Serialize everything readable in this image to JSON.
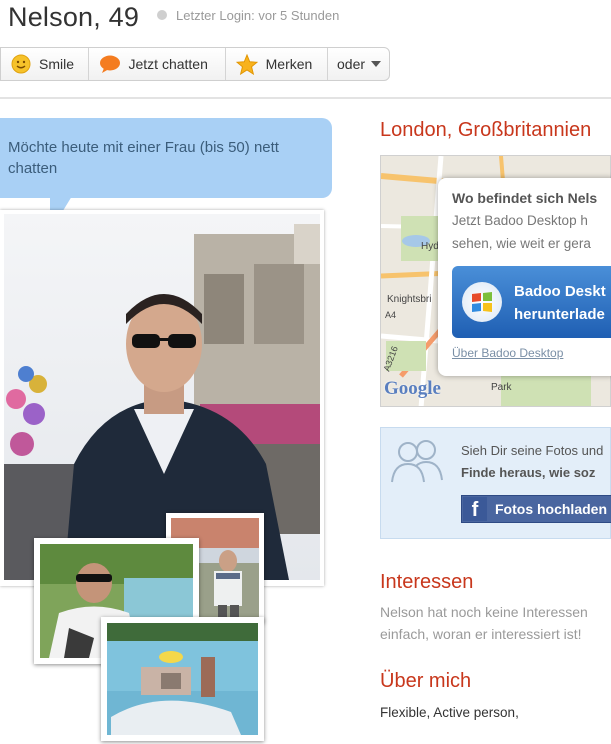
{
  "profile": {
    "name_age": "Nelson, 49",
    "last_login": "Letzter Login: vor 5 Stunden",
    "status_color": "#cfcfcf"
  },
  "actions": {
    "smile": "Smile",
    "chat": "Jetzt chatten",
    "merken": "Merken",
    "oder": "oder"
  },
  "bubble": {
    "text": "Möchte heute mit einer Frau (bis 50) nett chatten"
  },
  "location": {
    "title": "London, Großbritannien",
    "map_labels": [
      "Hyd",
      "Knightsbri",
      "A4",
      "A3216",
      "Park"
    ],
    "google": "Google",
    "popup": {
      "title": "Wo befindet sich Nels",
      "line1": "Jetzt Badoo Desktop h",
      "line2": "sehen, wie weit er gera",
      "download_line1": "Badoo Deskt",
      "download_line2": "herunterlade",
      "link": "Über Badoo Desktop"
    }
  },
  "photos_box": {
    "line1": "Sieh Dir seine Fotos und",
    "line2": "Finde heraus, wie soz",
    "fb_button": "Fotos hochladen",
    "fb_icon": "f"
  },
  "interests": {
    "heading": "Interessen",
    "line1": "Nelson hat noch keine Interessen",
    "line2": "einfach, woran er interessiert ist!"
  },
  "about": {
    "heading": "Über mich",
    "text": "Flexible, Active person,"
  },
  "colors": {
    "accent": "#c8371c",
    "bubble": "#a9d0f5",
    "facebook": "#3b5998"
  }
}
